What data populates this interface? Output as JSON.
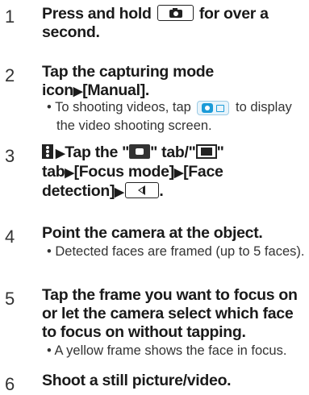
{
  "steps": [
    {
      "number": "1",
      "title_a": "Press and hold",
      "title_b": "for over a second."
    },
    {
      "number": "2",
      "title_a": "Tap the capturing mode icon",
      "title_b": "[Manual].",
      "note_a": "To shooting videos, tap",
      "note_b": "to display the video shooting screen."
    },
    {
      "number": "3",
      "title_a": "Tap the \"",
      "title_b": "\" tab/\"",
      "title_c": "\" tab",
      "title_d": "[Focus mode]",
      "title_e": "[Face detection]",
      "title_f": "."
    },
    {
      "number": "4",
      "title": "Point the camera at the object.",
      "note": "Detected faces are framed (up to 5 faces)."
    },
    {
      "number": "5",
      "title": "Tap the frame you want to focus on or let the camera select which face to focus on without tapping.",
      "note": "A yellow frame shows the face in focus."
    },
    {
      "number": "6",
      "title": "Shoot a still picture/video."
    }
  ],
  "glyphs": {
    "arrow": "▶",
    "bullet": "•"
  },
  "icons": [
    "camera-key-icon",
    "capture-mode-icon",
    "menu-icon",
    "still-tab-icon",
    "video-tab-icon",
    "back-key-icon"
  ]
}
